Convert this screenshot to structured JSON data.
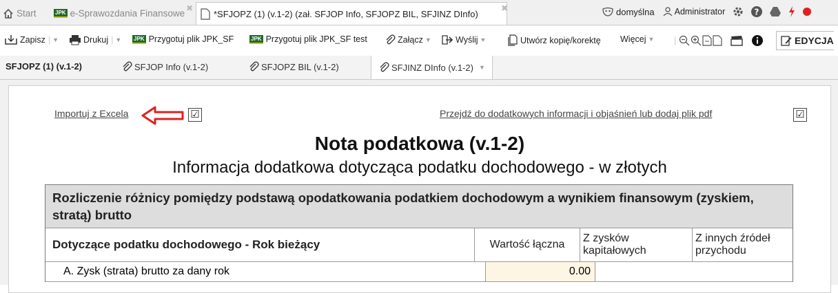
{
  "tabs": [
    {
      "label": "Start"
    },
    {
      "label": "e-Sprawozdania Finansowe"
    },
    {
      "label": "*SFJOPZ (1) (v.1-2) (zał. SFJOP Info, SFJOPZ BIL, SFJINZ DInfo)"
    }
  ],
  "jpk_badge": "JPK",
  "top_right": {
    "profile": "domyślna",
    "user": "Administrator"
  },
  "toolbar": {
    "save": "Zapisz",
    "print": "Drukuj",
    "prepare": "Przygotuj plik JPK_SF",
    "prepare_test": "Przygotuj plik JPK_SF test",
    "attach": "Załącz",
    "send": "Wyślij",
    "copy": "Utwórz kopię/korektę",
    "more": "Więcej",
    "mode": "EDYCJA"
  },
  "subtabs": [
    {
      "label": "SFJOPZ (1) (v.1-2)"
    },
    {
      "label": "SFJOP Info (v.1-2)"
    },
    {
      "label": "SFJOPZ BIL (v.1-2)"
    },
    {
      "label": "SFJINZ DInfo (v.1-2)"
    }
  ],
  "form": {
    "import_link": "Importuj z Excela",
    "info_link": "Przejdź do dodatkowych informacji i objaśnień lub dodaj plik pdf",
    "title": "Nota podatkowa (v.1-2)",
    "subtitle": "Informacja dodatkowa dotycząca podatku dochodowego - w złotych"
  },
  "table": {
    "section_title": "Rozliczenie różnicy pomiędzy podstawą opodatkowania podatkiem dochodowym a wynikiem finansowym (zyskiem, stratą) brutto",
    "headers": [
      "Dotyczące podatku dochodowego - Rok bieżący",
      "Wartość łączna",
      "Z zysków kapitałowych",
      "Z innych źródeł przychodu"
    ],
    "rows": [
      {
        "label": "A. Zysk (strata) brutto za dany rok",
        "value": "0.00"
      }
    ]
  },
  "colors": {
    "accent_red": "#e02020",
    "input_bg": "#fdf6e4"
  }
}
